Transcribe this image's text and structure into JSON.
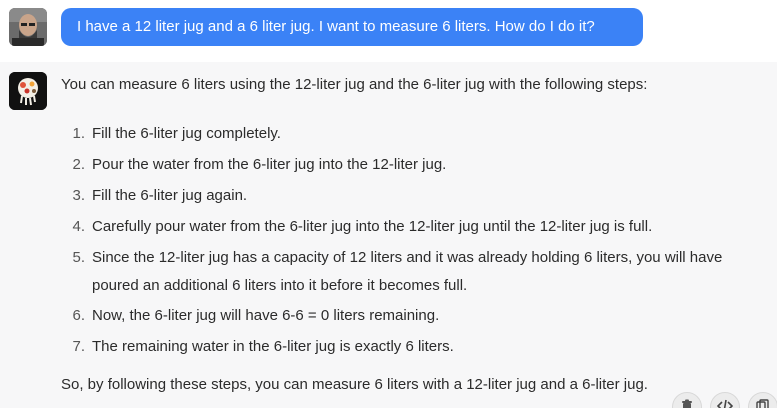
{
  "user_message": {
    "text": "I have a 12 liter jug and a 6 liter jug. I want to measure 6 liters. How do I do it?"
  },
  "assistant_message": {
    "intro": "You can measure 6 liters using the 12-liter jug and the 6-liter jug with the following steps:",
    "steps": [
      {
        "num": "1.",
        "text": "Fill the 6-liter jug completely."
      },
      {
        "num": "2.",
        "text": "Pour the water from the 6-liter jug into the 12-liter jug."
      },
      {
        "num": "3.",
        "text": "Fill the 6-liter jug again."
      },
      {
        "num": "4.",
        "text": "Carefully pour water from the 6-liter jug into the 12-liter jug until the 12-liter jug is full."
      },
      {
        "num": "5.",
        "text": "Since the 12-liter jug has a capacity of 12 liters and it was already holding 6 liters, you will have poured an additional 6 liters into it before it becomes full."
      },
      {
        "num": "6.",
        "text": "Now, the 6-liter jug will have 6-6 = 0 liters remaining."
      },
      {
        "num": "7.",
        "text": "The remaining water in the 6-liter jug is exactly 6 liters."
      }
    ],
    "outro": "So, by following these steps, you can measure 6 liters with a 12-liter jug and a 6-liter jug."
  },
  "actions": {
    "delete_icon": "trash-icon",
    "code_icon": "code-icon",
    "copy_icon": "copy-icon"
  },
  "colors": {
    "user_bubble": "#3b82f6",
    "assistant_bg": "#f7f7f8",
    "text": "#2b2b2b"
  }
}
